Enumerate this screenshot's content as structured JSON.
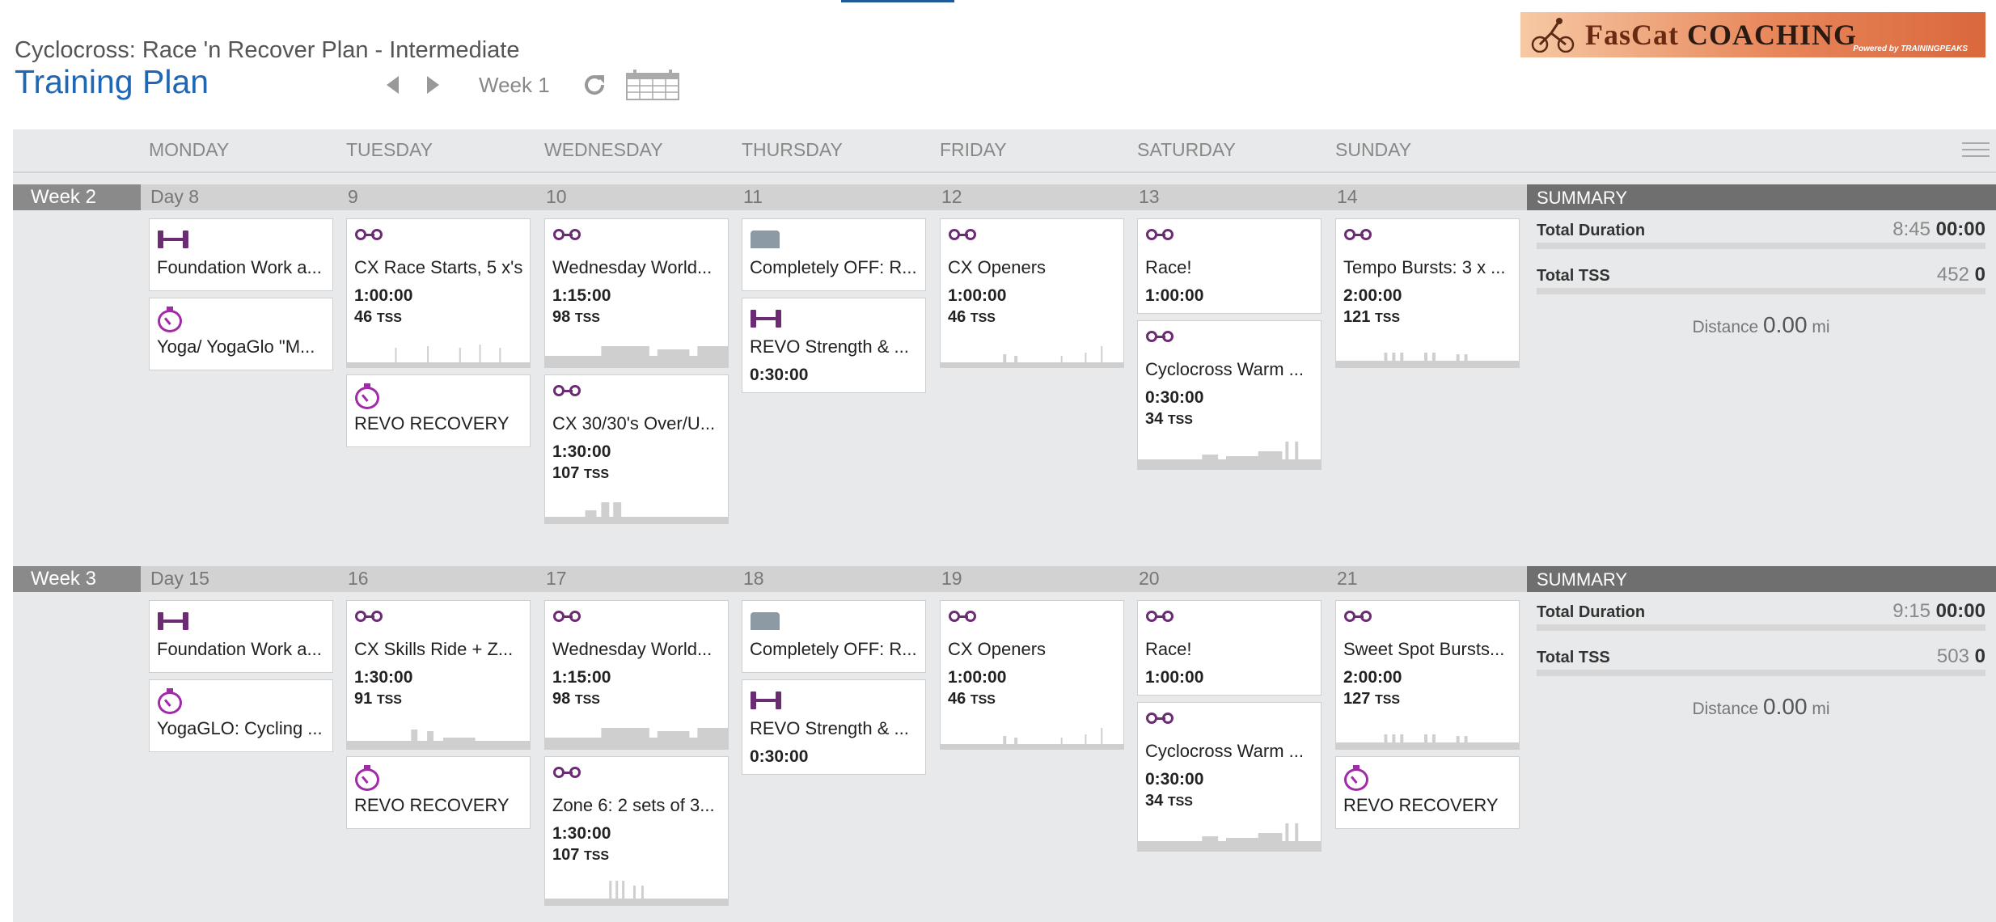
{
  "plan": {
    "name": "Cyclocross: Race 'n Recover Plan - Intermediate",
    "title": "Training Plan"
  },
  "nav": {
    "week_label": "Week 1"
  },
  "logo": {
    "brand": "FasCat",
    "brand2": "COACHING",
    "sub": "Powered by TRAININGPEAKS"
  },
  "days": [
    "MONDAY",
    "TUESDAY",
    "WEDNESDAY",
    "THURSDAY",
    "FRIDAY",
    "SATURDAY",
    "SUNDAY"
  ],
  "colors": {
    "accent": "#1f66b3",
    "bike": "#6b2c74",
    "recovery": "#a12aa8",
    "rest": "#8c9aa5"
  },
  "weeks": [
    {
      "label": "Week 2",
      "day_nums": [
        "Day 8",
        "9",
        "10",
        "11",
        "12",
        "13",
        "14"
      ],
      "summary": {
        "title": "SUMMARY",
        "duration_label": "Total Duration",
        "duration_grey": "8:45",
        "duration_bold": "00:00",
        "tss_label": "Total TSS",
        "tss_grey": "452",
        "tss_bold": "0",
        "distance_label": "Distance",
        "distance_value": "0.00",
        "distance_unit": "mi"
      },
      "days": [
        [
          {
            "icon": "strength",
            "title": "Foundation Work a...",
            "h": 90
          },
          {
            "icon": "recovery",
            "title": "Yoga/ YogaGlo \"M...",
            "h": 90
          }
        ],
        [
          {
            "icon": "bike",
            "title": "CX Race Starts, 5 x's",
            "duration": "1:00:00",
            "tss": "46",
            "tss_unit": "TSS",
            "h": 185,
            "graph": "starts"
          },
          {
            "icon": "recovery",
            "title": "REVO RECOVERY",
            "h": 90
          }
        ],
        [
          {
            "icon": "bike",
            "title": "Wednesday World...",
            "duration": "1:15:00",
            "tss": "98",
            "tss_unit": "TSS",
            "h": 185,
            "graph": "blocks"
          },
          {
            "icon": "bike",
            "title": "CX 30/30's Over/U...",
            "duration": "1:30:00",
            "tss": "107",
            "tss_unit": "TSS",
            "h": 185,
            "graph": "overunder"
          }
        ],
        [
          {
            "icon": "rest",
            "title": "Completely OFF: R...",
            "h": 90
          },
          {
            "icon": "strength",
            "title": "REVO Strength & ...",
            "duration": "0:30:00",
            "h": 118
          }
        ],
        [
          {
            "icon": "bike",
            "title": "CX Openers",
            "duration": "1:00:00",
            "tss": "46",
            "tss_unit": "TSS",
            "h": 185,
            "graph": "openers"
          }
        ],
        [
          {
            "icon": "bike",
            "title": "Race!",
            "duration": "1:00:00",
            "h": 118
          },
          {
            "icon": "bike",
            "title": "Cyclocross Warm ...",
            "duration": "0:30:00",
            "tss": "34",
            "tss_unit": "TSS",
            "h": 185,
            "graph": "warmup"
          }
        ],
        [
          {
            "icon": "bike",
            "title": "Tempo Bursts: 3 x ...",
            "duration": "2:00:00",
            "tss": "121",
            "tss_unit": "TSS",
            "h": 185,
            "graph": "tempo"
          }
        ]
      ]
    },
    {
      "label": "Week 3",
      "day_nums": [
        "Day 15",
        "16",
        "17",
        "18",
        "19",
        "20",
        "21"
      ],
      "summary": {
        "title": "SUMMARY",
        "duration_label": "Total Duration",
        "duration_grey": "9:15",
        "duration_bold": "00:00",
        "tss_label": "Total TSS",
        "tss_grey": "503",
        "tss_bold": "0",
        "distance_label": "Distance",
        "distance_value": "0.00",
        "distance_unit": "mi"
      },
      "days": [
        [
          {
            "icon": "strength",
            "title": "Foundation Work a...",
            "h": 90
          },
          {
            "icon": "recovery",
            "title": "YogaGLO: Cycling ...",
            "h": 90
          }
        ],
        [
          {
            "icon": "bike",
            "title": "CX Skills Ride + Z...",
            "duration": "1:30:00",
            "tss": "91",
            "tss_unit": "TSS",
            "h": 185,
            "graph": "skills"
          },
          {
            "icon": "recovery",
            "title": "REVO RECOVERY",
            "h": 90
          }
        ],
        [
          {
            "icon": "bike",
            "title": "Wednesday World...",
            "duration": "1:15:00",
            "tss": "98",
            "tss_unit": "TSS",
            "h": 185,
            "graph": "blocks"
          },
          {
            "icon": "bike",
            "title": "Zone 6: 2 sets of 3...",
            "duration": "1:30:00",
            "tss": "107",
            "tss_unit": "TSS",
            "h": 185,
            "graph": "zone6"
          }
        ],
        [
          {
            "icon": "rest",
            "title": "Completely OFF: R...",
            "h": 90
          },
          {
            "icon": "strength",
            "title": "REVO Strength & ...",
            "duration": "0:30:00",
            "h": 118
          }
        ],
        [
          {
            "icon": "bike",
            "title": "CX Openers",
            "duration": "1:00:00",
            "tss": "46",
            "tss_unit": "TSS",
            "h": 185,
            "graph": "openers"
          }
        ],
        [
          {
            "icon": "bike",
            "title": "Race!",
            "duration": "1:00:00",
            "h": 118
          },
          {
            "icon": "bike",
            "title": "Cyclocross Warm ...",
            "duration": "0:30:00",
            "tss": "34",
            "tss_unit": "TSS",
            "h": 185,
            "graph": "warmup"
          }
        ],
        [
          {
            "icon": "bike",
            "title": "Sweet Spot Bursts...",
            "duration": "2:00:00",
            "tss": "127",
            "tss_unit": "TSS",
            "h": 185,
            "graph": "tempo"
          },
          {
            "icon": "recovery",
            "title": "REVO RECOVERY",
            "h": 90
          }
        ]
      ]
    }
  ]
}
